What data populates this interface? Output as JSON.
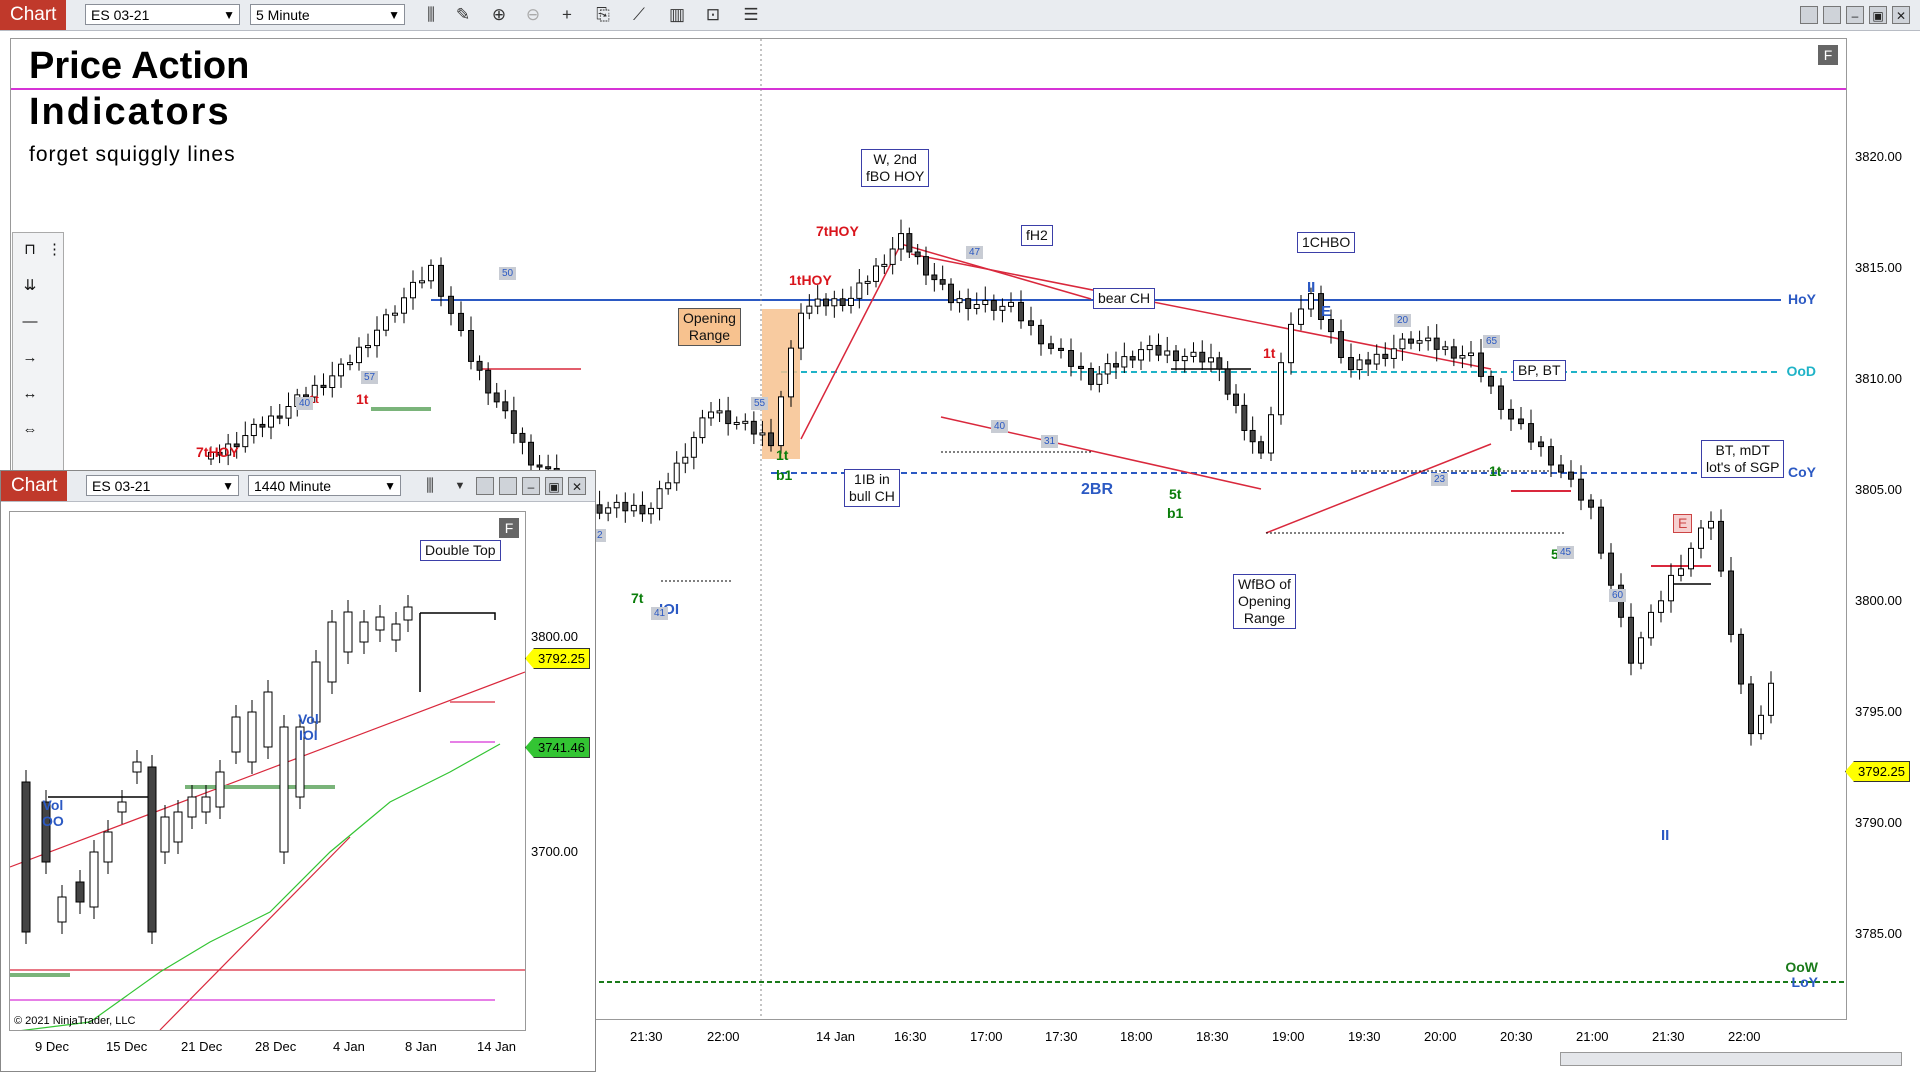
{
  "main": {
    "badge": "Chart",
    "instrument": "ES 03-21",
    "interval": "5 Minute",
    "title1": "Price Action",
    "title2": "Indicators",
    "subtitle": "forget squiggly lines",
    "corner_badge": "F",
    "y_axis": [
      "3820.00",
      "3815.00",
      "3810.00",
      "3805.00",
      "3800.00",
      "3795.00",
      "3790.00",
      "3785.00"
    ],
    "x_axis": [
      "21:30",
      "22:00",
      "14 Jan",
      "16:30",
      "17:00",
      "17:30",
      "18:00",
      "18:30",
      "19:00",
      "19:30",
      "20:00",
      "20:30",
      "21:00",
      "21:30",
      "22:00"
    ],
    "current_price": "3792.25",
    "right_labels": {
      "hoy": "HoY",
      "ood": "OoD",
      "coy": "CoY",
      "oow": "OoW",
      "loy": "LoY"
    },
    "colors": {
      "hoy": "#2b59c3",
      "ood": "#1fb3c7",
      "coy": "#2b59c3",
      "oow": "#1a7a1a",
      "title_line": "#d633d6",
      "bull_trend": "#d9283c",
      "price_tag": "#ffff00"
    },
    "annotations": {
      "w2nd": [
        "W, 2nd",
        "fBO HOY"
      ],
      "fh2": "fH2",
      "chbo": "1CHBO",
      "bear_ch": "bear CH",
      "bp_bt": "BP, BT",
      "bt_mdt": [
        "BT, mDT",
        "lot's of SGP"
      ],
      "opening_range": [
        "Opening",
        "Range"
      ],
      "ib_bull": [
        "1IB in",
        "bull CH"
      ],
      "wfbo": [
        "WfBO of",
        "Opening",
        "Range"
      ],
      "hoy7_left": "7tHOY",
      "hoy7_top": "7tHOY",
      "hoy1": "1tHOY",
      "t1_a": "1t",
      "t1_b": "1t",
      "t1_c": "1t",
      "t1_d": "1t",
      "t1_e": "1t",
      "t7": "7t",
      "t5": "5t",
      "b1_a": "b1",
      "b1_b": "b1",
      "br2": "2BR",
      "e_top": "E",
      "e_right": "E",
      "ii_top": "II",
      "ii_bot": "II",
      "ioi": "IOI",
      "five": "5"
    },
    "bar_numbers": [
      "40",
      "57",
      "50",
      "55",
      "47",
      "40",
      "31",
      "20",
      "65",
      "23",
      "45",
      "60",
      "41",
      "2"
    ]
  },
  "sub": {
    "badge": "Chart",
    "instrument": "ES 03-21",
    "interval": "1440 Minute",
    "corner_badge": "F",
    "y_axis": [
      "3800.00",
      "3700.00"
    ],
    "x_axis": [
      "9 Dec",
      "15 Dec",
      "21 Dec",
      "28 Dec",
      "4 Jan",
      "8 Jan",
      "14 Jan"
    ],
    "price_current": "3792.25",
    "price_ema": "3741.46",
    "copyright": "© 2021 NinjaTrader, LLC",
    "annotations": {
      "double_top": "Double Top",
      "vol_oo": [
        "Vol",
        "OO"
      ],
      "vol_ioi": [
        "Vol",
        "IOI"
      ]
    }
  }
}
